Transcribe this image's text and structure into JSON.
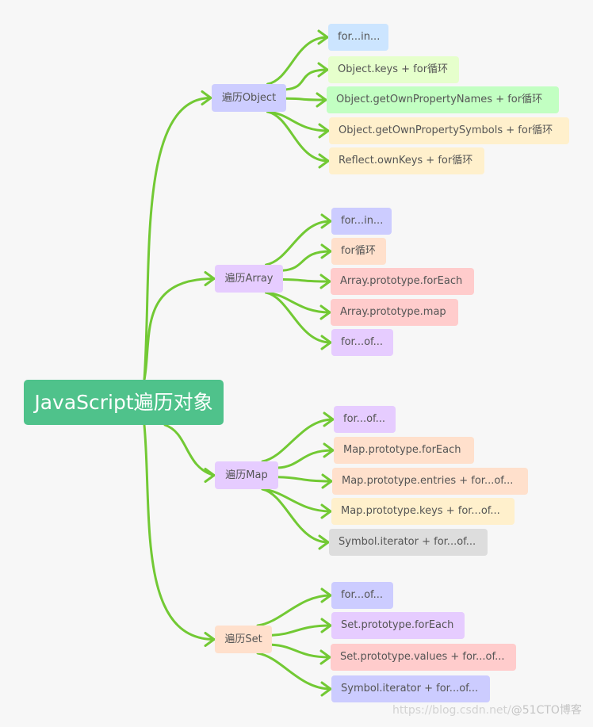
{
  "root": {
    "label": "JavaScript遍历对象",
    "color": "#4fc28b"
  },
  "edge_color": "#72c934",
  "branches": [
    {
      "label": "遍历Object",
      "color": "#cdcdff",
      "children": [
        {
          "label": "for...in...",
          "color": "#cce5ff"
        },
        {
          "label": "Object.keys + for循环",
          "color": "#e6ffcc"
        },
        {
          "label": "Object.getOwnPropertyNames + for循环",
          "color": "#c2ffc2"
        },
        {
          "label": "Object.getOwnPropertySymbols + for循环",
          "color": "#fff0cc"
        },
        {
          "label": "Reflect.ownKeys + for循环",
          "color": "#fff0cc"
        }
      ]
    },
    {
      "label": "遍历Array",
      "color": "#e6ccff",
      "children": [
        {
          "label": "for...in...",
          "color": "#ccccff"
        },
        {
          "label": "for循环",
          "color": "#ffe0cc"
        },
        {
          "label": "Array.prototype.forEach",
          "color": "#ffcccc"
        },
        {
          "label": "Array.prototype.map",
          "color": "#ffcccc"
        },
        {
          "label": "for...of...",
          "color": "#e6ccff"
        }
      ]
    },
    {
      "label": "遍历Map",
      "color": "#e6ccff",
      "children": [
        {
          "label": "for...of...",
          "color": "#e6ccff"
        },
        {
          "label": "Map.prototype.forEach",
          "color": "#ffe0cc"
        },
        {
          "label": "Map.prototype.entries + for...of...",
          "color": "#ffe0cc"
        },
        {
          "label": "Map.prototype.keys + for...of...",
          "color": "#fff0cc"
        },
        {
          "label": "Symbol.iterator + for...of...",
          "color": "#dddddd"
        }
      ]
    },
    {
      "label": "遍历Set",
      "color": "#ffe0cc",
      "children": [
        {
          "label": "for...of...",
          "color": "#ccccff"
        },
        {
          "label": "Set.prototype.forEach",
          "color": "#e6ccff"
        },
        {
          "label": "Set.prototype.values + for...of...",
          "color": "#ffcccc"
        },
        {
          "label": "Symbol.iterator + for...of...",
          "color": "#ccccff"
        }
      ]
    }
  ],
  "watermark": {
    "url": "https://blog.csdn.net/",
    "brand": "@51CTO博客"
  }
}
